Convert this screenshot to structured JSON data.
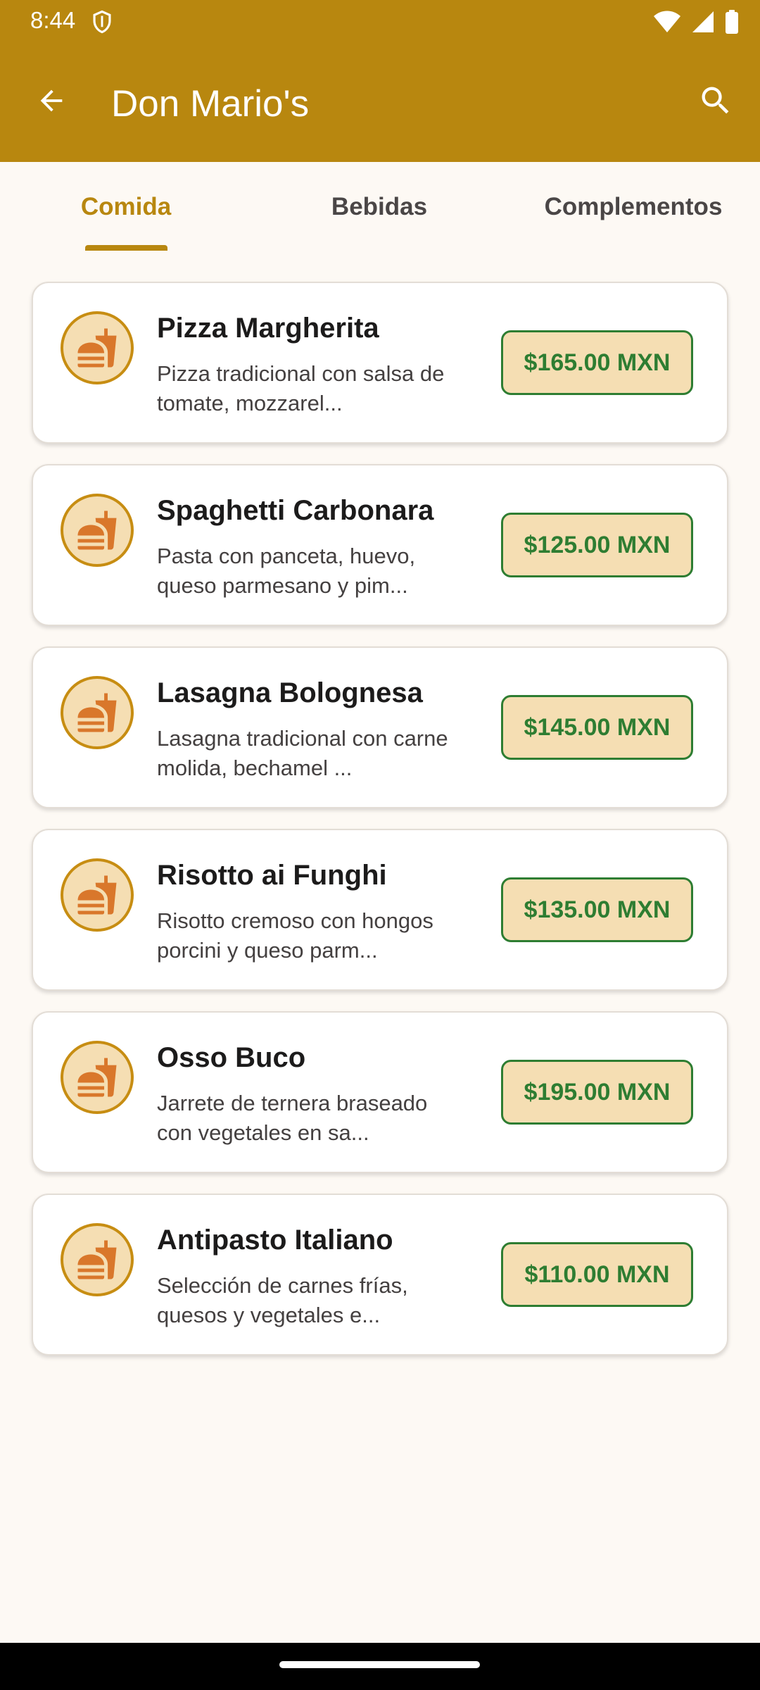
{
  "status_bar": {
    "time": "8:44"
  },
  "app_bar": {
    "title": "Don Mario's",
    "bg_color": "#B8870F"
  },
  "tabs": [
    {
      "label": "Comida",
      "active": true
    },
    {
      "label": "Bebidas",
      "active": false
    },
    {
      "label": "Complementos",
      "active": false
    }
  ],
  "items": [
    {
      "name": "Pizza Margherita",
      "desc_line1": "Pizza tradicional con salsa de",
      "desc_line2": "tomate, mozzarel...",
      "price": "$165.00 MXN",
      "icon": "fastfood-icon"
    },
    {
      "name": "Spaghetti Carbonara",
      "desc_line1": "Pasta con panceta, huevo,",
      "desc_line2": "queso parmesano y pim...",
      "price": "$125.00 MXN",
      "icon": "fastfood-icon"
    },
    {
      "name": "Lasagna Bolognesa",
      "desc_line1": "Lasagna tradicional con carne",
      "desc_line2": "molida, bechamel ...",
      "price": "$145.00 MXN",
      "icon": "fastfood-icon"
    },
    {
      "name": "Risotto ai Funghi",
      "desc_line1": "Risotto cremoso con hongos",
      "desc_line2": "porcini y queso parm...",
      "price": "$135.00 MXN",
      "icon": "fastfood-icon"
    },
    {
      "name": "Osso Buco",
      "desc_line1": "Jarrete de ternera braseado",
      "desc_line2": "con vegetales en sa...",
      "price": "$195.00 MXN",
      "icon": "fastfood-icon"
    },
    {
      "name": "Antipasto Italiano",
      "desc_line1": "Selección de carnes frías,",
      "desc_line2": "quesos y vegetales e...",
      "price": "$110.00 MXN",
      "icon": "fastfood-icon"
    }
  ],
  "colors": {
    "accent": "#B8870F",
    "price_text": "#2E7D32",
    "price_bg": "#F5DEB3"
  }
}
